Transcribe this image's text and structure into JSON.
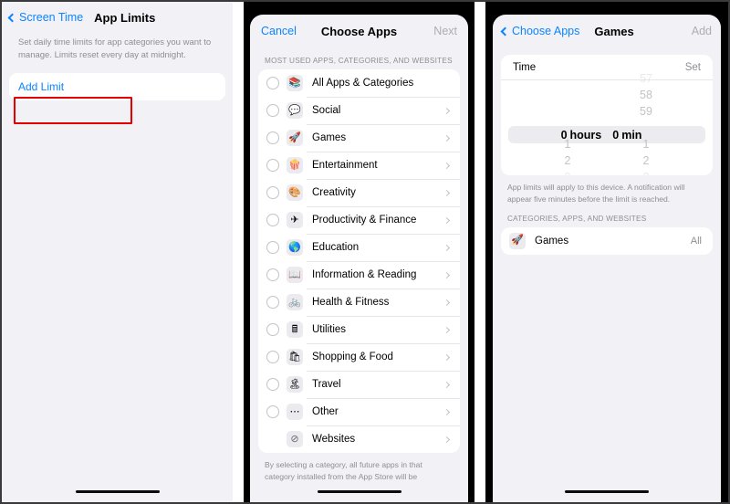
{
  "panel1": {
    "nav": {
      "back_label": "Screen Time",
      "title": "App Limits"
    },
    "description": "Set daily time limits for app categories you want to manage. Limits reset every day at midnight.",
    "add_limit_label": "Add Limit"
  },
  "panel2": {
    "nav": {
      "cancel_label": "Cancel",
      "title": "Choose Apps",
      "next_label": "Next"
    },
    "section_header": "MOST USED APPS, CATEGORIES, AND WEBSITES",
    "footer": "By selecting a category, all future apps in that category installed from the App Store will be",
    "rows": [
      {
        "label": "All Apps & Categories",
        "icon": "all-apps-icon",
        "glyph": "📚",
        "radio": true,
        "chevron": false
      },
      {
        "label": "Social",
        "icon": "social-icon",
        "glyph": "💬",
        "radio": true,
        "chevron": true
      },
      {
        "label": "Games",
        "icon": "games-icon",
        "glyph": "🚀",
        "radio": true,
        "chevron": true
      },
      {
        "label": "Entertainment",
        "icon": "entertainment-icon",
        "glyph": "🍿",
        "radio": true,
        "chevron": true
      },
      {
        "label": "Creativity",
        "icon": "creativity-icon",
        "glyph": "🎨",
        "radio": true,
        "chevron": true
      },
      {
        "label": "Productivity & Finance",
        "icon": "productivity-icon",
        "glyph": "✈",
        "radio": true,
        "chevron": true
      },
      {
        "label": "Education",
        "icon": "education-icon",
        "glyph": "🌎",
        "radio": true,
        "chevron": true
      },
      {
        "label": "Information & Reading",
        "icon": "reading-icon",
        "glyph": "📖",
        "radio": true,
        "chevron": true
      },
      {
        "label": "Health & Fitness",
        "icon": "health-icon",
        "glyph": "🚲",
        "radio": true,
        "chevron": true
      },
      {
        "label": "Utilities",
        "icon": "utilities-icon",
        "glyph": "🖩",
        "radio": true,
        "chevron": true
      },
      {
        "label": "Shopping & Food",
        "icon": "shopping-icon",
        "glyph": "🛍",
        "radio": true,
        "chevron": true
      },
      {
        "label": "Travel",
        "icon": "travel-icon",
        "glyph": "🏝",
        "radio": true,
        "chevron": true
      },
      {
        "label": "Other",
        "icon": "other-icon",
        "glyph": "⋯",
        "radio": true,
        "chevron": true
      },
      {
        "label": "Websites",
        "icon": "websites-compass-icon",
        "glyph": "⊘",
        "radio": false,
        "chevron": true
      }
    ]
  },
  "panel3": {
    "nav": {
      "back_label": "Choose Apps",
      "title": "Games",
      "add_label": "Add"
    },
    "time_card": {
      "label": "Time",
      "set_label": "Set"
    },
    "picker": {
      "hours_above": [
        "",
        "",
        ""
      ],
      "minutes_above": [
        "57",
        "58",
        "59"
      ],
      "selected_hours": "0",
      "hours_unit": "hours",
      "selected_minutes": "0",
      "minutes_unit": "min",
      "hours_below": [
        "1",
        "2",
        "3"
      ],
      "minutes_below": [
        "1",
        "2",
        "3"
      ]
    },
    "note": "App limits will apply to this device. A notification will appear five minutes before the limit is reached.",
    "section_header": "CATEGORIES, APPS, AND WEBSITES",
    "selected_row": {
      "label": "Games",
      "icon": "games-icon",
      "glyph": "🚀",
      "trailing": "All"
    }
  },
  "annotation": {
    "color": "#e60000",
    "target": "add-limit-row"
  }
}
